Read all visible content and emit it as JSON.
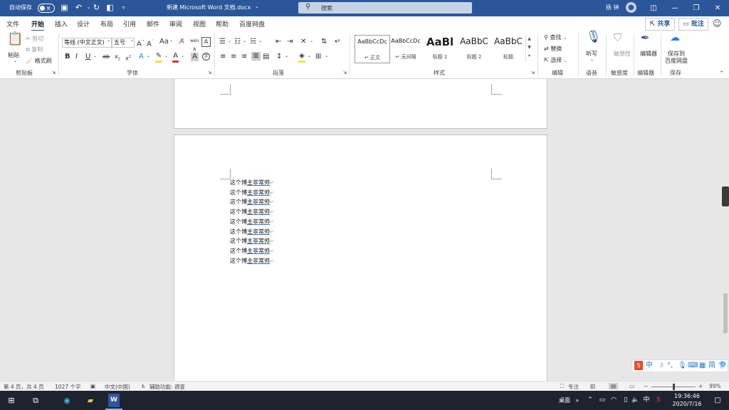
{
  "titlebar": {
    "autosave_label": "自动保存",
    "autosave_state": "关",
    "doc_title": "新建 Microsoft Word 文档.docx",
    "search_placeholder": "搜索",
    "user_name": "扬 钟",
    "bg_color": "#2b579a"
  },
  "tabs": [
    "文件",
    "开始",
    "插入",
    "设计",
    "布局",
    "引用",
    "邮件",
    "审阅",
    "视图",
    "帮助",
    "百度网盘"
  ],
  "active_tab": "开始",
  "share_label": "共享",
  "comment_label": "批注",
  "ribbon": {
    "clipboard": {
      "paste": "粘贴",
      "cut": "剪切",
      "copy": "复制",
      "format_painter": "格式刷",
      "group": "剪贴板"
    },
    "font": {
      "font_name": "等线 (中文正文)",
      "font_size": "五号",
      "group": "字体"
    },
    "paragraph": {
      "group": "段落"
    },
    "styles": {
      "items": [
        {
          "preview": "AaBbCcDc",
          "name": "正文"
        },
        {
          "preview": "AaBbCcDc",
          "name": "无间隔"
        },
        {
          "preview": "AaBl",
          "name": "标题 1"
        },
        {
          "preview": "AaBbC",
          "name": "标题 2"
        },
        {
          "preview": "AaBbC",
          "name": "标题"
        }
      ],
      "group": "样式"
    },
    "editing": {
      "find": "查找",
      "replace": "替换",
      "select": "选择",
      "group": "编辑"
    },
    "voice": {
      "dictate": "听写",
      "group": "语音"
    },
    "sensitivity": {
      "label": "敏感性",
      "group": "敏感度"
    },
    "editor": {
      "label": "编辑器",
      "group": "编辑器"
    },
    "save": {
      "label1": "保存到",
      "label2": "百度网盘",
      "group": "保存"
    }
  },
  "document": {
    "lines": [
      {
        "plain": "这个博",
        "underlined": "主非常帅"
      },
      {
        "plain": "这个博",
        "underlined": "主非常帅"
      },
      {
        "plain": "这个博",
        "underlined": "主非常帅"
      },
      {
        "plain": "这个博",
        "underlined": "主非常帅"
      },
      {
        "plain": "这个博",
        "underlined": "主非常帅"
      },
      {
        "plain": "这个博",
        "underlined": "主非常帅"
      },
      {
        "plain": "这个博",
        "underlined": "主非常帅"
      },
      {
        "plain": "这个博",
        "underlined": "主非常帅"
      },
      {
        "plain": "这个博",
        "underlined": "主非常帅"
      }
    ],
    "paragraph_mark": "↵"
  },
  "statusbar": {
    "page": "第 4 页，共 4 页",
    "words": "1027 个字",
    "language": "中文(中国)",
    "accessibility": "辅助功能: 调查",
    "focus": "专注",
    "zoom": "99%"
  },
  "taskbar": {
    "desktop_label": "桌面",
    "ime": "中",
    "time": "19:36:46",
    "date": "2020/7/16"
  }
}
